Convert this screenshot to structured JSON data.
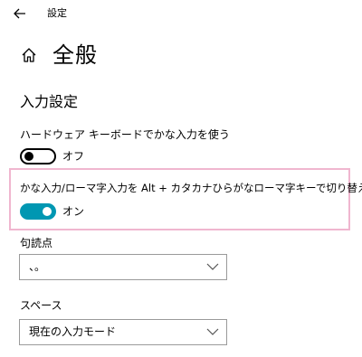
{
  "window": {
    "title": "設定",
    "back_icon": "arrow-left-icon"
  },
  "header": {
    "home_icon": "home-icon",
    "title": "全般"
  },
  "section": {
    "title": "入力設定"
  },
  "settings": {
    "hardware_kana": {
      "label": "ハードウェア キーボードでかな入力を使う",
      "enabled": false,
      "state_label": "オフ"
    },
    "kana_romaji_switch": {
      "label": "かな入力/ローマ字入力を Alt + カタカナひらがなローマ字キーで切り替える",
      "enabled": true,
      "state_label": "オン"
    },
    "punctuation": {
      "label": "句読点",
      "selected": "、。"
    },
    "space": {
      "label": "スペース",
      "selected": "現在の入力モード"
    }
  },
  "colors": {
    "toggle_on": "#0097b2",
    "highlight_border": "#f0b6cf"
  }
}
